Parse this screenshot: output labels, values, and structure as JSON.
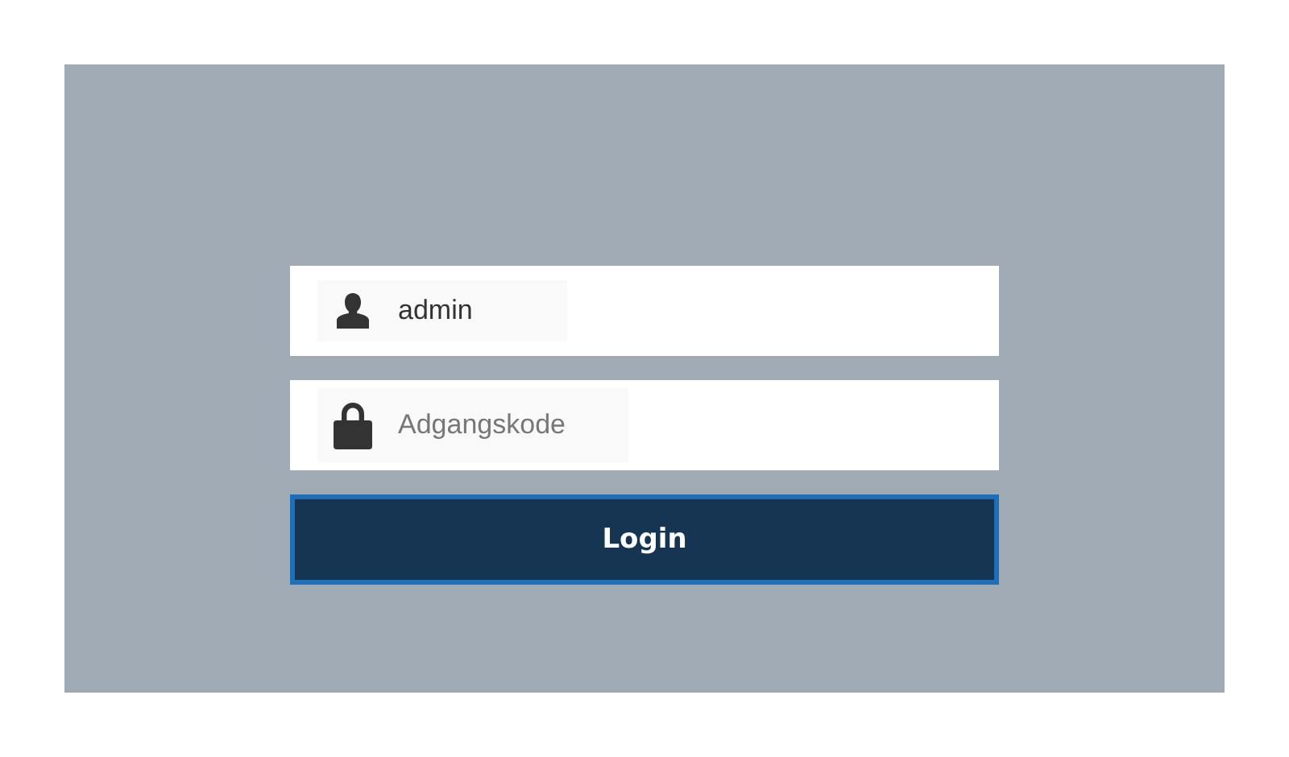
{
  "fields": [
    {
      "kind": "username",
      "value": "admin"
    },
    {
      "kind": "password",
      "placeholder": "Adgangskode"
    }
  ],
  "button": {
    "label": "Login"
  }
}
